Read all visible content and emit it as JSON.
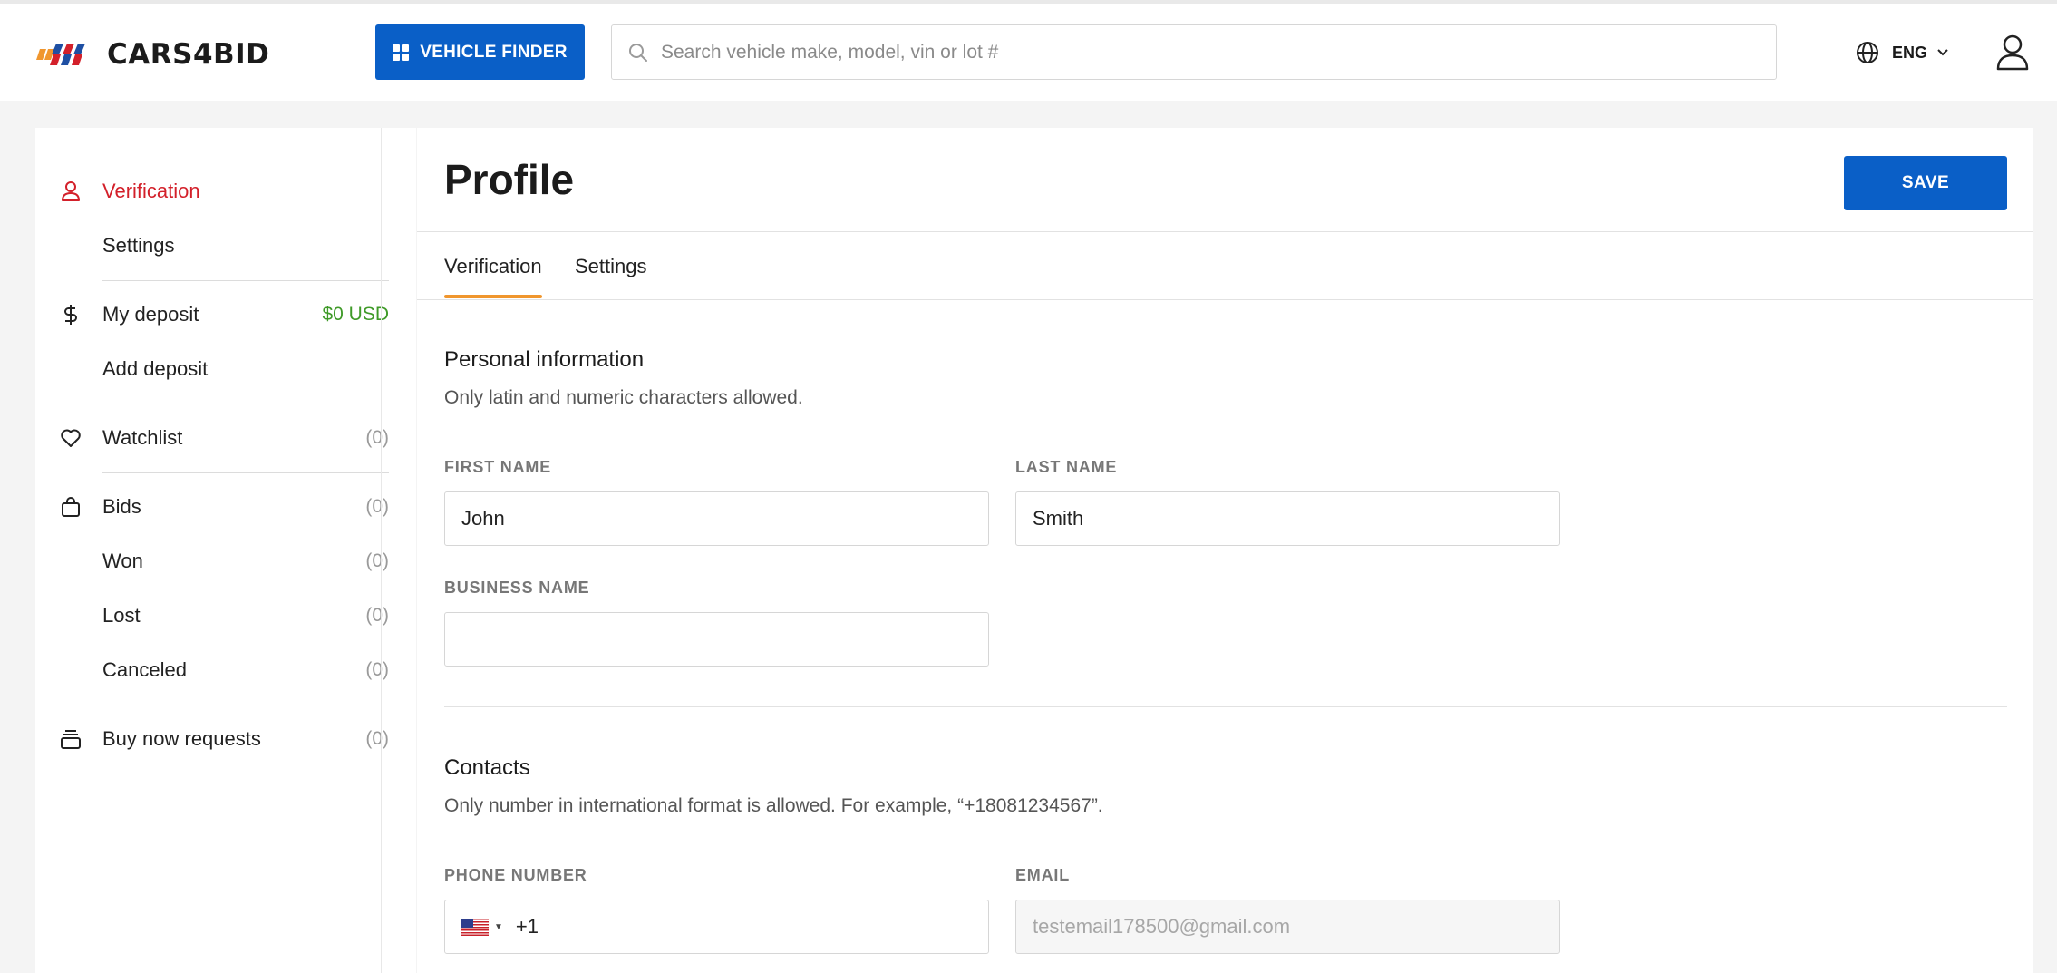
{
  "header": {
    "logo_text": "CARS4BID",
    "vehicle_finder_label": "VEHICLE FINDER",
    "search_placeholder": "Search vehicle make, model, vin or lot #",
    "language": "ENG"
  },
  "sidebar": {
    "verification": "Verification",
    "settings": "Settings",
    "my_deposit": "My deposit",
    "deposit_amount": "$0 USD",
    "add_deposit": "Add deposit",
    "watchlist": "Watchlist",
    "watchlist_count": "(0)",
    "bids": "Bids",
    "bids_count": "(0)",
    "won": "Won",
    "won_count": "(0)",
    "lost": "Lost",
    "lost_count": "(0)",
    "canceled": "Canceled",
    "canceled_count": "(0)",
    "buy_now": "Buy now requests",
    "buy_now_count": "(0)"
  },
  "main": {
    "title": "Profile",
    "save_label": "SAVE",
    "tabs": [
      {
        "label": "Verification",
        "active": true
      },
      {
        "label": "Settings",
        "active": false
      }
    ],
    "personal": {
      "title": "Personal information",
      "subtitle": "Only latin and numeric characters allowed.",
      "first_name_label": "FIRST NAME",
      "first_name": "John",
      "last_name_label": "LAST NAME",
      "last_name": "Smith",
      "business_name_label": "BUSINESS NAME",
      "business_name": ""
    },
    "contacts": {
      "title": "Contacts",
      "subtitle": "Only number in international format is allowed. For example, “+18081234567”.",
      "phone_label": "PHONE NUMBER",
      "phone_value": "+1",
      "email_label": "EMAIL",
      "email_value": "testemail178500@gmail.com"
    }
  },
  "colors": {
    "primary": "#0a5fc7",
    "active_nav": "#d3202a",
    "deposit_green": "#3f9a28",
    "tab_underline": "#f0962e"
  }
}
